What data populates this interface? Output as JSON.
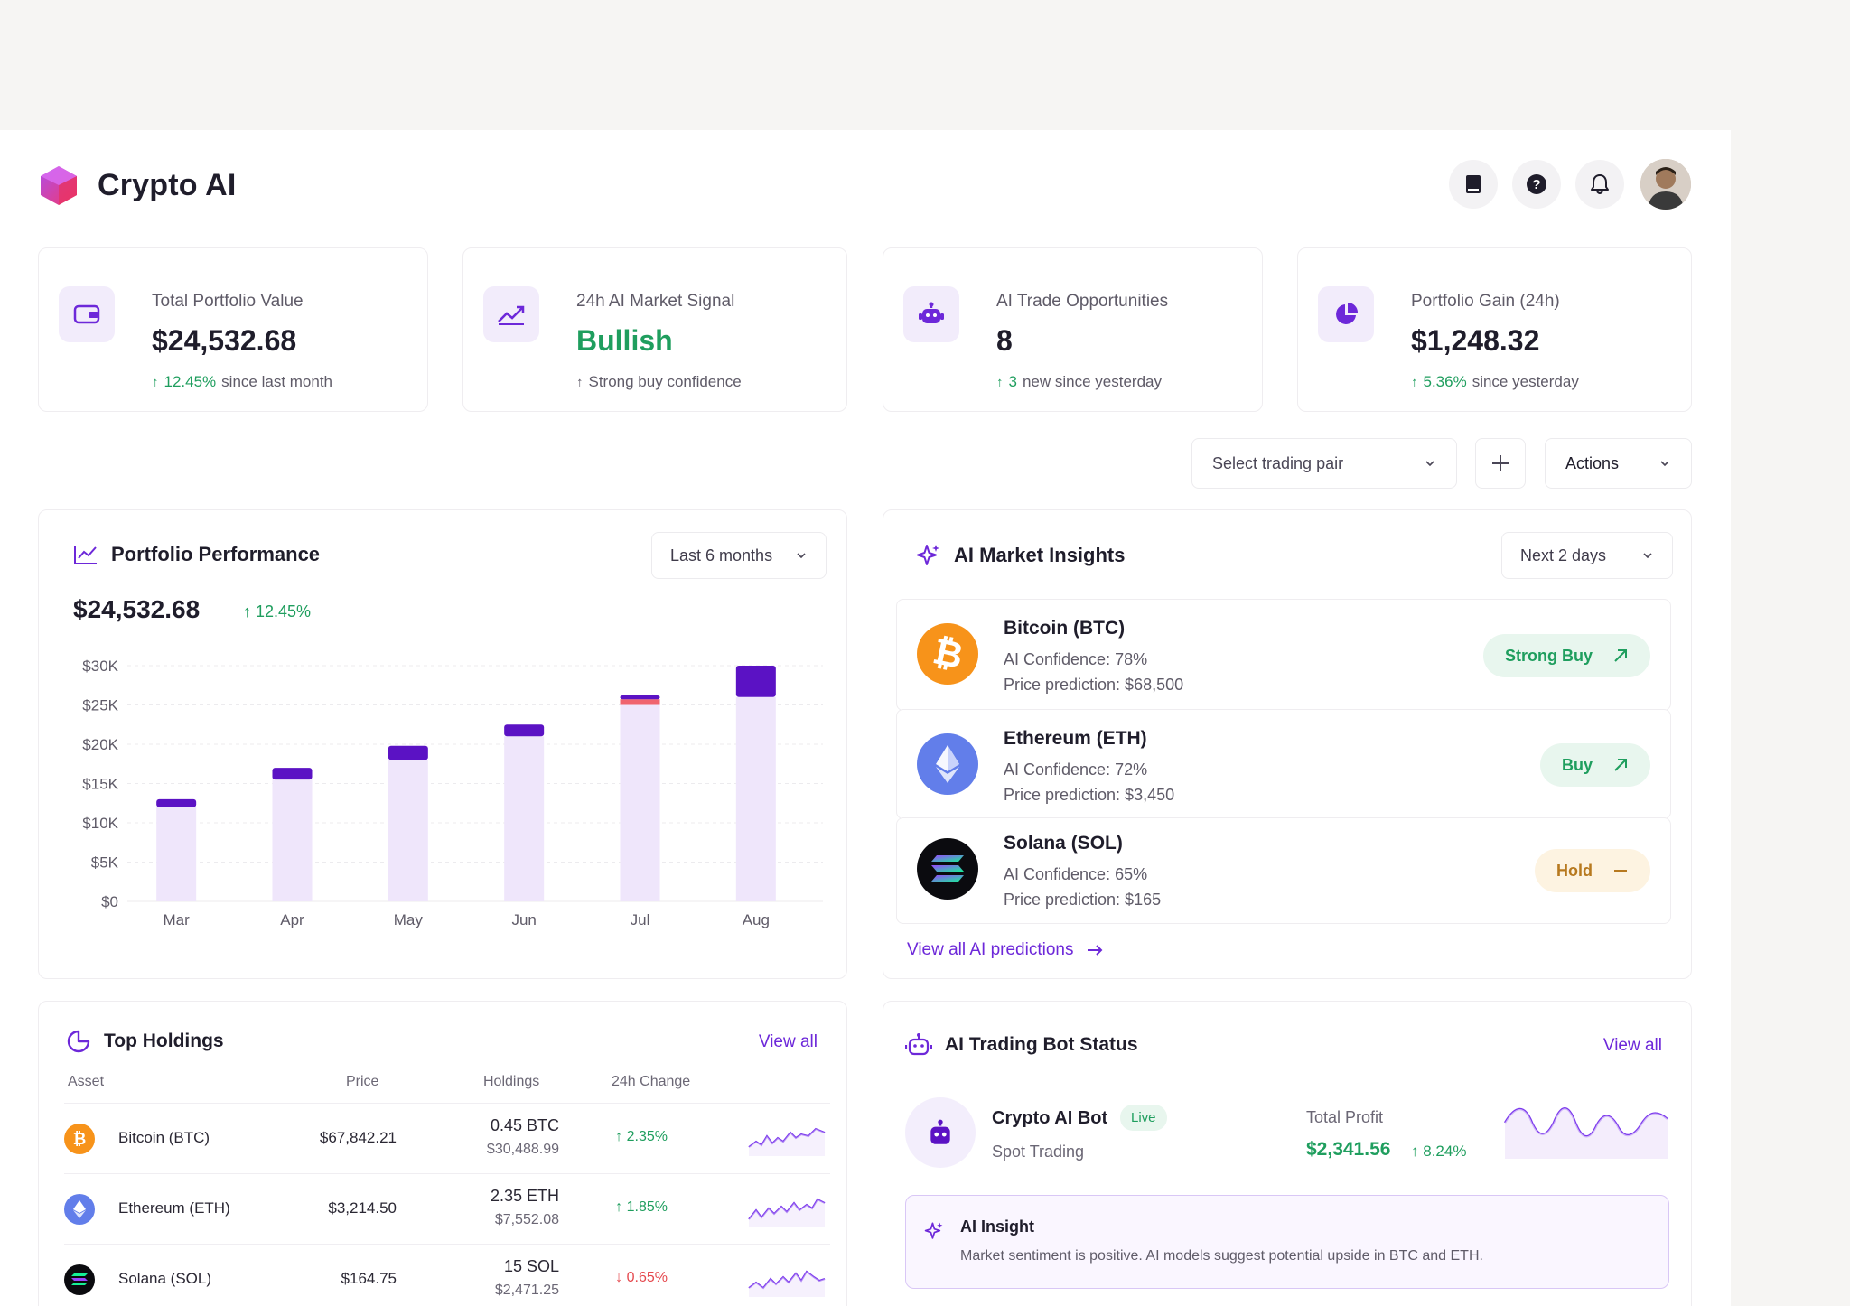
{
  "app": {
    "brand": "Crypto AI"
  },
  "header_icons": [
    "book-icon",
    "help-icon",
    "bell-icon"
  ],
  "stats": [
    {
      "label": "Total Portfolio Value",
      "value": "$24,532.68",
      "change": "12.45%",
      "change_text": "since last month",
      "icon": "wallet-icon"
    },
    {
      "label": "24h AI Market Signal",
      "value": "Bullish",
      "change": "",
      "change_text": "Strong buy confidence",
      "icon": "trend-up-icon"
    },
    {
      "label": "AI Trade Opportunities",
      "value": "8",
      "change": "3",
      "change_text": "new since yesterday",
      "icon": "robot-icon"
    },
    {
      "label": "Portfolio Gain (24h)",
      "value": "$1,248.32",
      "change": "5.36%",
      "change_text": "since yesterday",
      "icon": "pie-chart-icon"
    }
  ],
  "toolbar": {
    "pair_placeholder": "Select trading pair",
    "actions_label": "Actions"
  },
  "performance": {
    "title": "Portfolio Performance",
    "range": "Last 6 months",
    "value": "$24,532.68",
    "change": "12.45%"
  },
  "chart_data": {
    "type": "bar",
    "categories": [
      "Mar",
      "Apr",
      "May",
      "Jun",
      "Jul",
      "Aug"
    ],
    "series": [
      {
        "values": [
          12000,
          15500,
          18000,
          21000,
          25000,
          26000
        ]
      },
      {
        "values": [
          1000,
          1500,
          1800,
          1500,
          1200,
          4000
        ]
      }
    ],
    "highlight_color_jul": "#f0646e",
    "y_ticks": [
      "$0",
      "$5K",
      "$10K",
      "$15K",
      "$20K",
      "$25K",
      "$30K"
    ],
    "ylim": [
      0,
      30000
    ],
    "grid": true,
    "colors": {
      "base": "#efe6fb",
      "top": "#5b12c4"
    }
  },
  "insights": {
    "title": "AI Market Insights",
    "range": "Next 2 days",
    "items": [
      {
        "name": "Bitcoin (BTC)",
        "confidence": "AI Confidence: 78%",
        "prediction": "Price prediction: $68,500",
        "action": "Strong Buy",
        "tone": "green"
      },
      {
        "name": "Ethereum (ETH)",
        "confidence": "AI Confidence: 72%",
        "prediction": "Price prediction: $3,450",
        "action": "Buy",
        "tone": "green"
      },
      {
        "name": "Solana (SOL)",
        "confidence": "AI Confidence: 65%",
        "prediction": "Price prediction: $165",
        "action": "Hold",
        "tone": "amber"
      }
    ],
    "view_all": "View all AI predictions"
  },
  "holdings": {
    "title": "Top Holdings",
    "view_all": "View all",
    "columns": [
      "Asset",
      "Price",
      "Holdings",
      "24h Change"
    ],
    "rows": [
      {
        "name": "Bitcoin (BTC)",
        "price": "$67,842.21",
        "amount": "0.45 BTC",
        "value": "$30,488.99",
        "change": "2.35%",
        "dir": "up"
      },
      {
        "name": "Ethereum (ETH)",
        "price": "$3,214.50",
        "amount": "2.35 ETH",
        "value": "$7,552.08",
        "change": "1.85%",
        "dir": "up"
      },
      {
        "name": "Solana (SOL)",
        "price": "$164.75",
        "amount": "15 SOL",
        "value": "$2,471.25",
        "change": "0.65%",
        "dir": "down"
      }
    ]
  },
  "bot": {
    "title": "AI Trading Bot Status",
    "view_all": "View all",
    "name": "Crypto AI Bot",
    "status": "Live",
    "type": "Spot Trading",
    "profit_label": "Total Profit",
    "profit": "$2,341.56",
    "profit_change": "8.24%",
    "insight_title": "AI Insight",
    "insight_text": "Market sentiment is positive. AI models suggest potential upside in BTC and ETH."
  }
}
